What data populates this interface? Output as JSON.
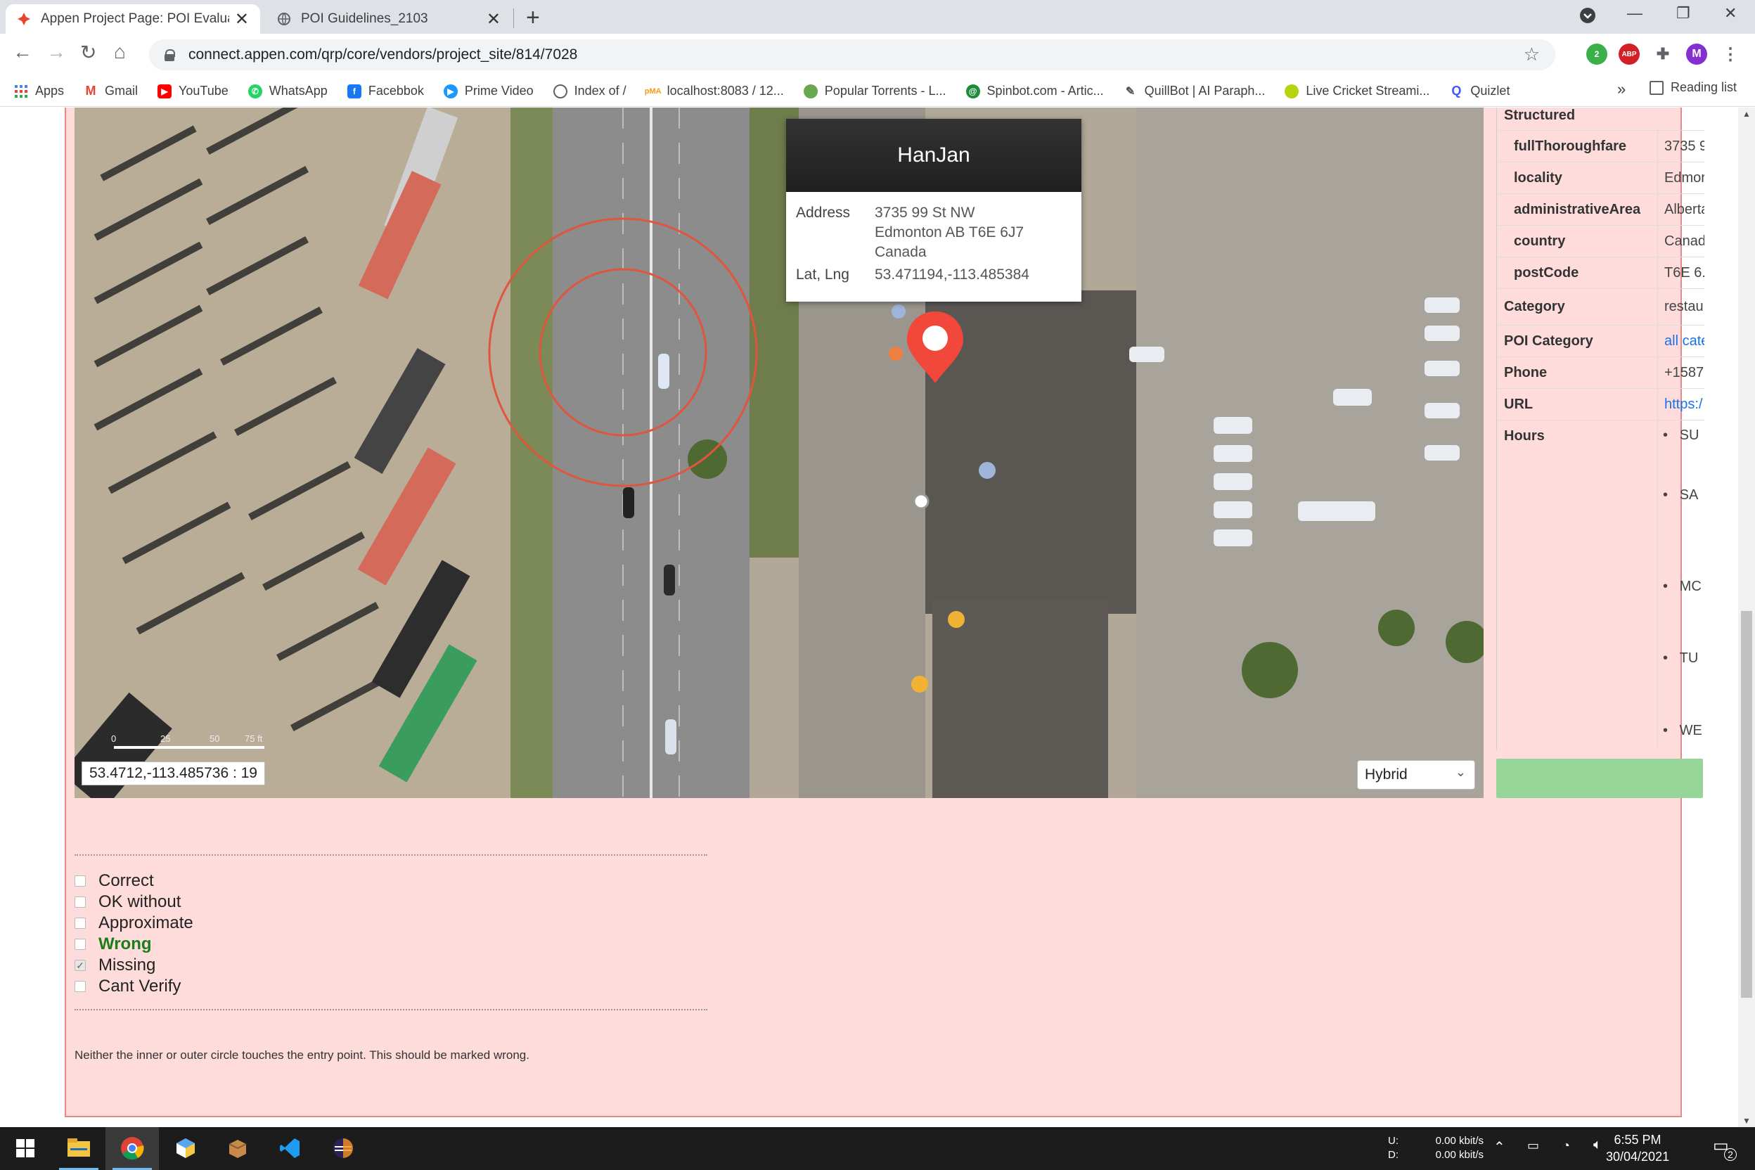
{
  "browser": {
    "tabs": [
      {
        "title": "Appen Project Page: POI Evaluati",
        "active": true
      },
      {
        "title": "POI Guidelines_2103",
        "active": false
      }
    ],
    "url": "connect.appen.com/qrp/core/vendors/project_site/814/7028",
    "extension_badge": "2",
    "abp_label": "ABP",
    "profile_initial": "M"
  },
  "bookmarks": [
    {
      "label": "Apps",
      "icon": "apps-grid-icon"
    },
    {
      "label": "Gmail",
      "icon": "gmail-icon"
    },
    {
      "label": "YouTube",
      "icon": "youtube-icon"
    },
    {
      "label": "WhatsApp",
      "icon": "whatsapp-icon"
    },
    {
      "label": "Facebbok",
      "icon": "facebook-icon"
    },
    {
      "label": "Prime Video",
      "icon": "prime-video-icon"
    },
    {
      "label": "Index of /",
      "icon": "globe-icon"
    },
    {
      "label": "localhost:8083 / 12...",
      "icon": "phpmyadmin-icon"
    },
    {
      "label": "Popular Torrents - L...",
      "icon": "torrent-icon"
    },
    {
      "label": "Spinbot.com - Artic...",
      "icon": "spinbot-icon"
    },
    {
      "label": "QuillBot | AI Paraph...",
      "icon": "quillbot-icon"
    },
    {
      "label": "Live Cricket Streami...",
      "icon": "cricket-icon"
    },
    {
      "label": "Quizlet",
      "icon": "quizlet-icon"
    }
  ],
  "bookmarks_more": "»",
  "reading_list": "Reading list",
  "map": {
    "popup": {
      "title": "HanJan",
      "address_label": "Address",
      "address_lines": [
        "3735 99 St NW",
        "Edmonton AB T6E 6J7",
        "Canada"
      ],
      "latlng_label": "Lat, Lng",
      "latlng": "53.471194,-113.485384"
    },
    "coordinates": "53.4712,-113.485736 : 19",
    "scale_labels": [
      "0",
      "25",
      "50",
      "75 ft"
    ],
    "map_type": "Hybrid"
  },
  "details": {
    "section_label": "Structured",
    "structured": [
      {
        "key": "fullThoroughfare",
        "value": "3735 9"
      },
      {
        "key": "locality",
        "value": "Edmor"
      },
      {
        "key": "administrativeArea",
        "value": "Alberta"
      },
      {
        "key": "country",
        "value": "Canad"
      },
      {
        "key": "postCode",
        "value": "T6E 6."
      }
    ],
    "fields": [
      {
        "key": "Category",
        "value": "restau"
      },
      {
        "key": "POI Category",
        "value": "all cate",
        "link": true
      },
      {
        "key": "Phone",
        "value": "+1587"
      },
      {
        "key": "URL",
        "value": "https:/",
        "link": true
      },
      {
        "key": "Hours",
        "value": ""
      }
    ],
    "hours": [
      "SU",
      "SA",
      "MC",
      "TU",
      "WE"
    ]
  },
  "evaluation": {
    "options": [
      {
        "label": "Correct",
        "checked": false,
        "highlight": false
      },
      {
        "label": "OK without",
        "checked": false,
        "highlight": false
      },
      {
        "label": "Approximate",
        "checked": false,
        "highlight": false
      },
      {
        "label": "Wrong",
        "checked": false,
        "highlight": true
      },
      {
        "label": "Missing",
        "checked": true,
        "highlight": false
      },
      {
        "label": "Cant Verify",
        "checked": false,
        "highlight": false
      }
    ],
    "note": "Neither the inner or outer circle touches the entry point. This should be marked wrong."
  },
  "taskbar": {
    "net_up_label": "U:",
    "net_down_label": "D:",
    "net_up": "0.00 kbit/s",
    "net_down": "0.00 kbit/s",
    "time": "6:55 PM",
    "date": "30/04/2021",
    "notification_count": "2"
  }
}
